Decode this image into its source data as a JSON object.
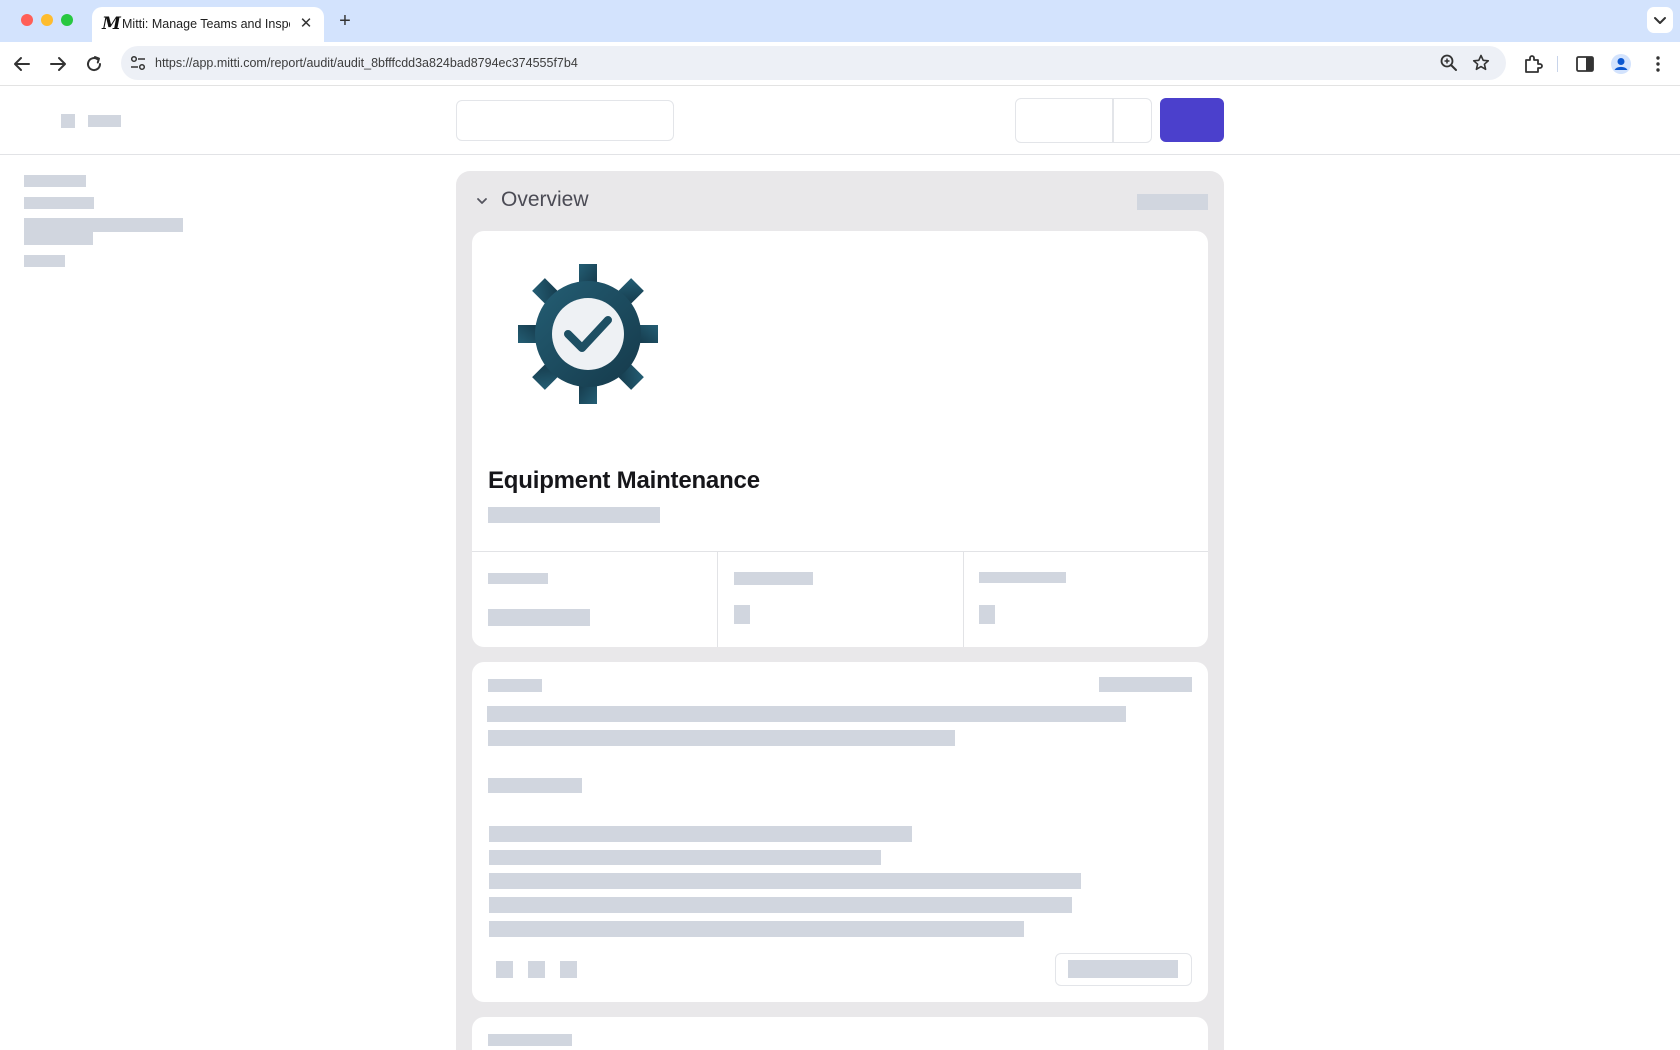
{
  "browser": {
    "tab_title": "Mitti: Manage Teams and Inspect...",
    "tab_favicon": "M",
    "tab_close": "✕",
    "new_tab": "+",
    "url": "https://app.mitti.com/report/audit/audit_8bfffcdd3a824bad8794ec374555f7b4"
  },
  "overview": {
    "title": "Overview",
    "card_title": "Equipment Maintenance"
  },
  "colors": {
    "primary": "#4b40cc",
    "placeholder": "#d1d6df",
    "gear": "#1d4f63"
  }
}
